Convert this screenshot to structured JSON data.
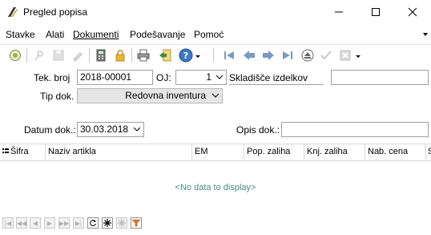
{
  "window": {
    "title": "Pregled popisa"
  },
  "menu": {
    "items": [
      "Stavke",
      "Alati",
      "Dokumenti",
      "Podešavanje",
      "Pomoć"
    ]
  },
  "toolbar": {
    "icons": [
      "refresh-icon",
      "pin-icon",
      "save-icon",
      "edit-icon",
      "calculator-icon",
      "lock-icon",
      "print-icon",
      "export-icon",
      "help-icon",
      "first-record-icon",
      "prev-record-icon",
      "next-record-icon",
      "last-record-icon",
      "eject-icon",
      "check-icon",
      "cancel-icon"
    ]
  },
  "form": {
    "tek_broj_label": "Tek. broj",
    "tek_broj_value": "2018-00001",
    "oj_label": "OJ:",
    "oj_value": "1",
    "oj_name": "Skladišče izdelkov",
    "tip_dok_label": "Tip dok.",
    "tip_dok_value": "Redovna inventura",
    "datum_label": "Datum dok.:",
    "datum_value": "30.03.2018",
    "opis_label": "Opis dok.:",
    "opis_value": ""
  },
  "grid": {
    "columns": [
      "Šifra",
      "Naziv artikla",
      "EM",
      "Pop. zaliha",
      "Knj. zaliha",
      "Nab. cena",
      "S"
    ],
    "empty_text": "<No data to display>"
  }
}
